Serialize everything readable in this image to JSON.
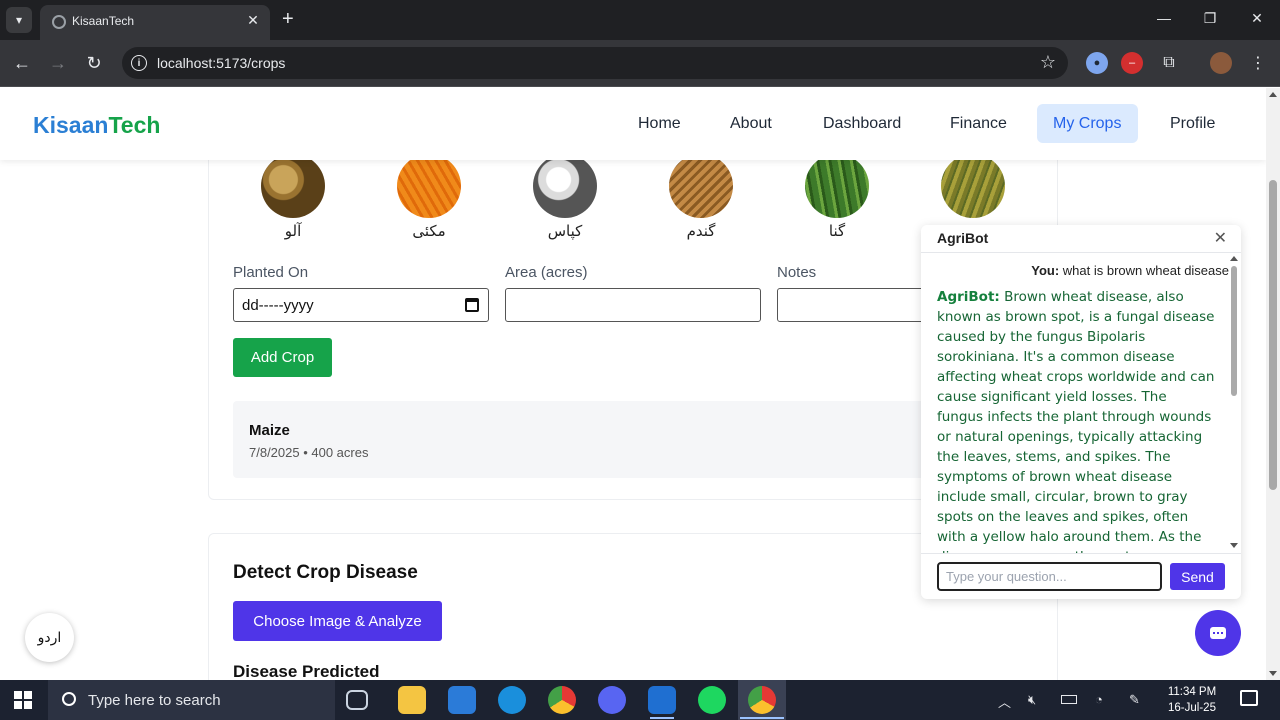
{
  "browser": {
    "tab_title": "KisaanTech",
    "url": "localhost:5173/crops"
  },
  "site": {
    "logo_part1": "Kisaan",
    "logo_part2": "Tech",
    "nav": [
      {
        "label": "Home"
      },
      {
        "label": "About"
      },
      {
        "label": "Dashboard"
      },
      {
        "label": "Finance"
      },
      {
        "label": "My Crops",
        "active": true
      },
      {
        "label": "Profile"
      }
    ]
  },
  "crop_options": [
    {
      "label": "آلو",
      "icon": "potato-icon"
    },
    {
      "label": "مکئی",
      "icon": "maize-icon"
    },
    {
      "label": "کپاس",
      "icon": "cotton-icon"
    },
    {
      "label": "گندم",
      "icon": "wheat-icon"
    },
    {
      "label": "گنا",
      "icon": "sugarcane-icon"
    },
    {
      "label": "",
      "icon": "rice-icon"
    }
  ],
  "form": {
    "planted_label": "Planted On",
    "planted_value": "dd-----yyyy",
    "area_label": "Area (acres)",
    "notes_label": "Notes",
    "add_button": "Add Crop"
  },
  "crops_list": [
    {
      "name": "Maize",
      "meta": "7/8/2025 • 400 acres"
    }
  ],
  "disease": {
    "title": "Detect Crop Disease",
    "analyze_button": "Choose Image & Analyze",
    "predicted_title": "Disease Predicted"
  },
  "lang_toggle": "اردو",
  "chat": {
    "title": "AgriBot",
    "user_prefix": "You:",
    "user_message": "what is brown wheat disease",
    "bot_prefix": "AgriBot:",
    "bot_message": "Brown wheat disease, also known as brown spot, is a fungal disease caused by the fungus Bipolaris sorokiniana. It's a common disease affecting wheat crops worldwide and can cause significant yield losses. The fungus infects the plant through wounds or natural openings, typically attacking the leaves, stems, and spikes. The symptoms of brown wheat disease include small, circular, brown to gray spots on the leaves and spikes, often with a yellow halo around them. As the disease progresses, the spots can merge, causing large areas of",
    "input_placeholder": "Type your question...",
    "send_label": "Send"
  },
  "taskbar": {
    "search_placeholder": "Type here to search",
    "time": "11:34 PM",
    "date": "16-Jul-25"
  },
  "colors": {
    "brand_blue": "#2b7fd4",
    "brand_green": "#16a34a",
    "accent_purple": "#4f35e8",
    "bot_text": "#166534"
  }
}
